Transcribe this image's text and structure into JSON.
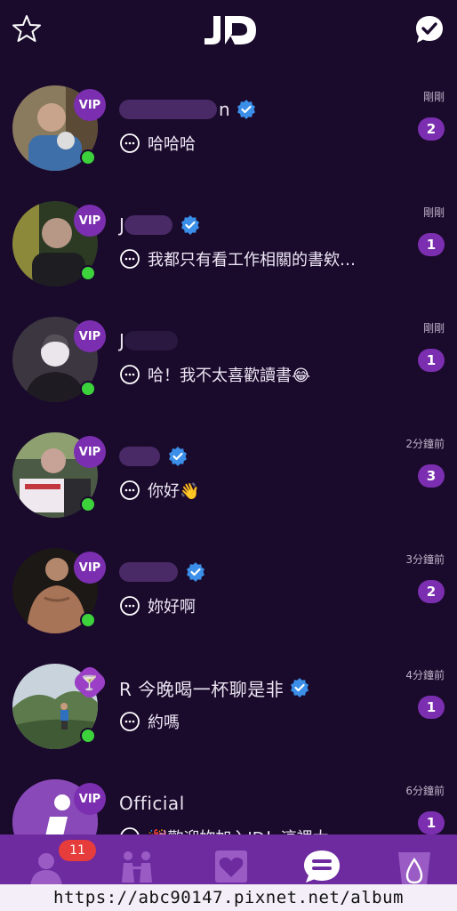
{
  "header": {
    "logo_text": "JD"
  },
  "chats": [
    {
      "name_suffix": "n",
      "verified": true,
      "message": "哈哈哈",
      "time": "剛剛",
      "unread": "2",
      "vip": "VIP",
      "online": true
    },
    {
      "name_suffix": "J",
      "verified": true,
      "message": "我都只有看工作相關的書欸…",
      "time": "剛剛",
      "unread": "1",
      "vip": "VIP",
      "online": true
    },
    {
      "name_suffix": "J",
      "verified": false,
      "message": "哈！我不太喜歡讀書😂",
      "time": "剛剛",
      "unread": "1",
      "vip": "VIP",
      "online": true
    },
    {
      "name_suffix": "",
      "verified": true,
      "message": "你好👋",
      "time": "2分鐘前",
      "unread": "3",
      "vip": "VIP",
      "online": true
    },
    {
      "name_suffix": "",
      "verified": true,
      "message": "妳好啊",
      "time": "3分鐘前",
      "unread": "2",
      "vip": "VIP",
      "online": true
    },
    {
      "name_suffix": "R 今晚喝一杯聊是非",
      "verified": true,
      "message": "約嗎",
      "time": "4分鐘前",
      "unread": "1",
      "vip": "🍸",
      "online": true
    },
    {
      "name_suffix": "Official",
      "verified": false,
      "message": "🎉歡迎妳加入JD！這裡太",
      "time": "6分鐘前",
      "unread": "1",
      "vip": "VIP",
      "online": false
    }
  ],
  "bottom_nav": {
    "notification_count": "11"
  },
  "watermark": "https://abc90147.pixnet.net/album",
  "colors": {
    "background": "#1a0a2c",
    "accent": "#7b2fb0",
    "nav": "#6d2b9f",
    "online": "#3bd23b",
    "alert": "#e63c3c"
  }
}
